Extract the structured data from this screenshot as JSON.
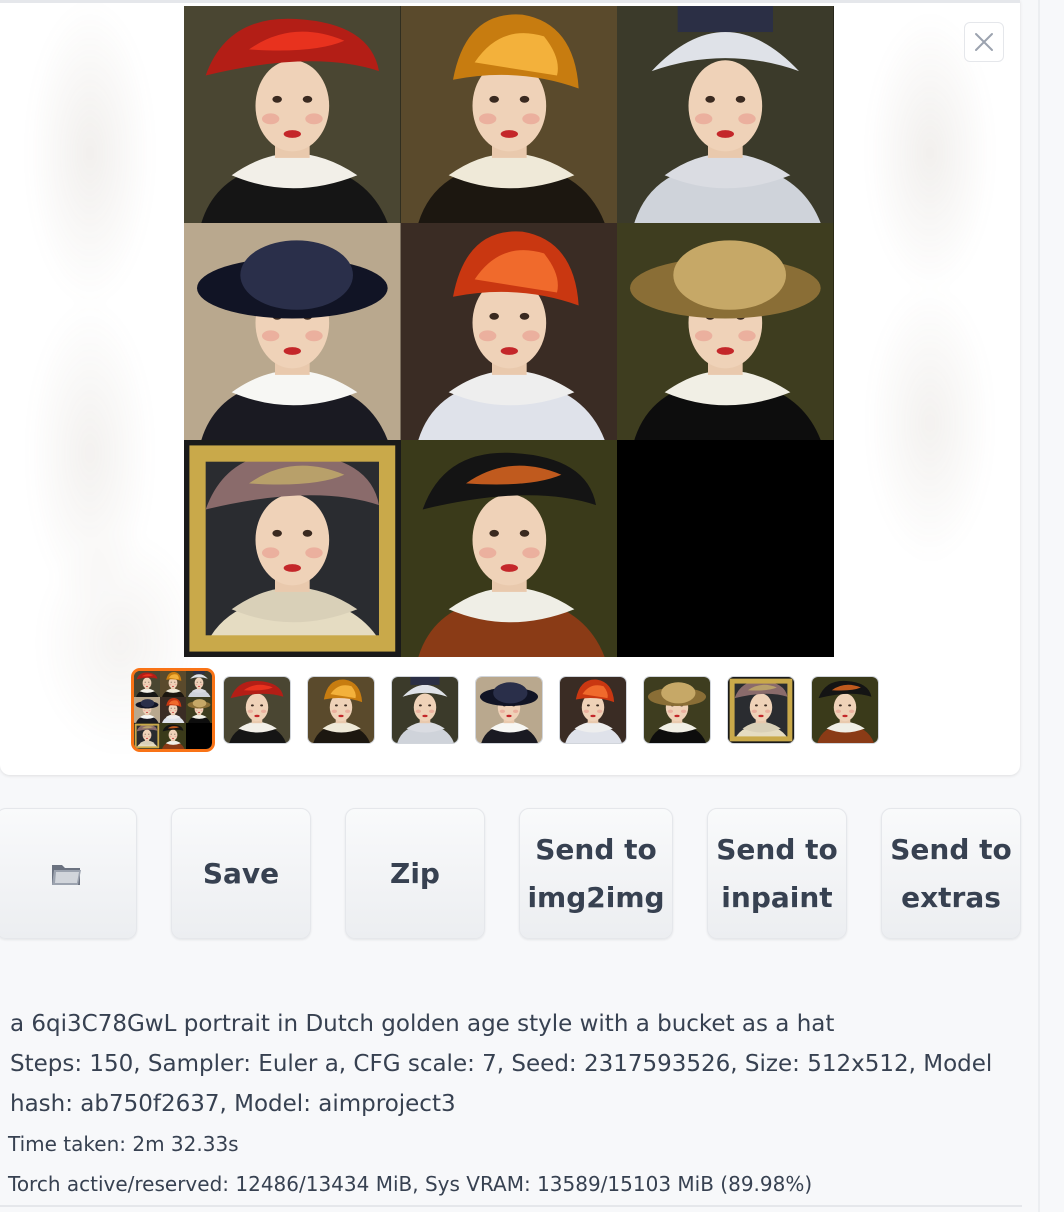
{
  "gallery": {
    "close_icon": "close-icon",
    "tiles": [
      {
        "hat": "#b31e16",
        "hat2": "#e8321e",
        "bg": "#4a4632",
        "collar": "#f2efe8",
        "dress": "#151515",
        "style": "beret"
      },
      {
        "hat": "#c77c10",
        "hat2": "#f3b13b",
        "bg": "#5a4a2c",
        "collar": "#efe9d8",
        "dress": "#1c1710",
        "style": "bucket"
      },
      {
        "hat": "#2b2f45",
        "hat2": "#dfe2e8",
        "bg": "#3b3a2a",
        "collar": "#dadce2",
        "dress": "#cfd3da",
        "style": "bonnet"
      },
      {
        "hat": "#111425",
        "hat2": "#2a2f4a",
        "bg": "#b9a88e",
        "collar": "#f7f7f4",
        "dress": "#1a1a22",
        "style": "wide"
      },
      {
        "hat": "#c93711",
        "hat2": "#f06a2c",
        "bg": "#3a2c24",
        "collar": "#eeeeee",
        "dress": "#dfe2ea",
        "style": "bucket"
      },
      {
        "hat": "#8a6e36",
        "hat2": "#c6a867",
        "bg": "#3e3d1f",
        "collar": "#f1efe5",
        "dress": "#0d0d0d",
        "style": "wide"
      },
      {
        "hat": "#8a6b6b",
        "hat2": "#b8a06a",
        "bg": "#2a2c30",
        "collar": "#d9d0b8",
        "dress": "#e5dcc2",
        "style": "frame"
      },
      {
        "hat": "#141414",
        "hat2": "#c05a1e",
        "bg": "#3a3a1a",
        "collar": "#efeee6",
        "dress": "#8a3b16",
        "style": "beret"
      }
    ]
  },
  "buttons": {
    "folder_icon": "folder-icon",
    "save": "Save",
    "zip": "Zip",
    "send_img2img": "Send to\nimg2img",
    "send_inpaint": "Send to\ninpaint",
    "send_extras": "Send to\nextras"
  },
  "info": {
    "prompt": "a 6qi3C78GwL portrait in Dutch golden age style with a bucket as a hat",
    "params_line1": "Steps: 150, Sampler: Euler a, CFG scale: 7, Seed: 2317593526, Size: 512x512, Model",
    "params_line2": "hash: ab750f2637, Model: aimproject3",
    "time_taken": "Time taken: 2m 32.33s",
    "vram": "Torch active/reserved: 12486/13434 MiB, Sys VRAM: 13589/15103 MiB (89.98%)"
  }
}
